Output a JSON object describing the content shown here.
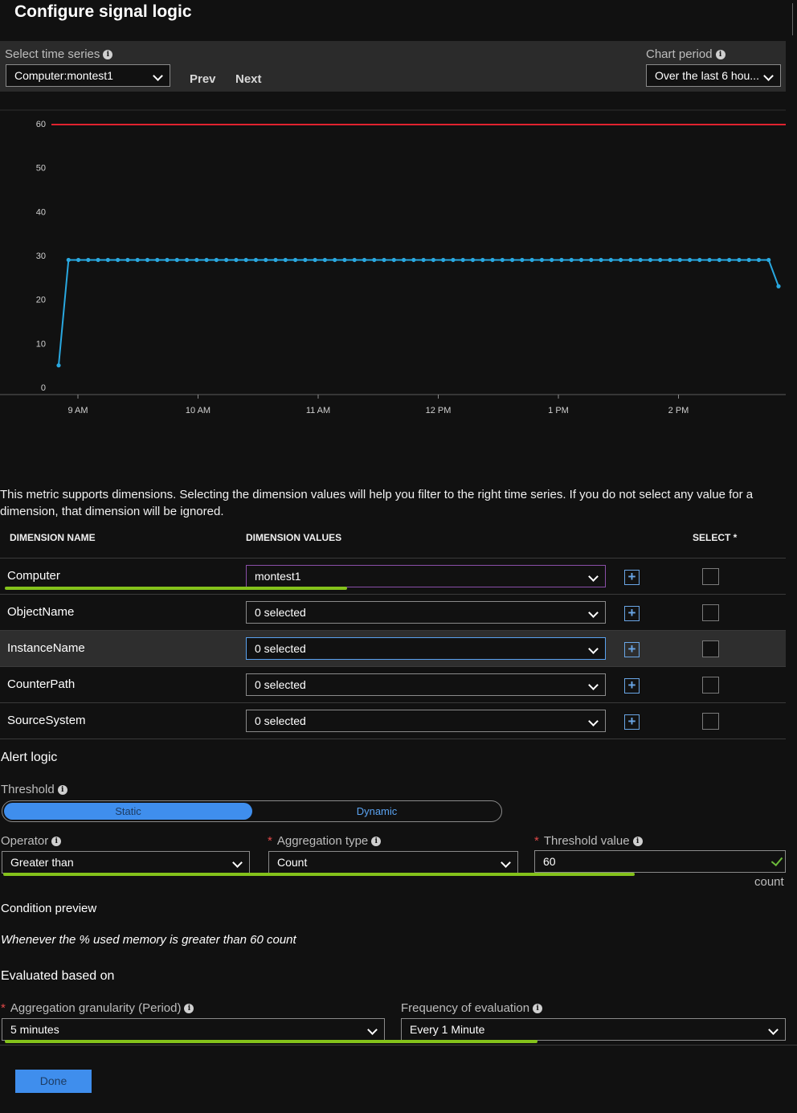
{
  "header": {
    "title": "Configure signal logic"
  },
  "toolbar": {
    "time_series_label": "Select time series",
    "time_series_value": "Computer:montest1",
    "prev_label": "Prev",
    "next_label": "Next",
    "chart_period_label": "Chart period",
    "chart_period_value": "Over the last 6 hou..."
  },
  "chart_data": {
    "type": "line",
    "y_ticks": [
      "60",
      "50",
      "40",
      "30",
      "20",
      "10",
      "0"
    ],
    "ylim": [
      0,
      60
    ],
    "x_ticks": [
      "9 AM",
      "10 AM",
      "11 AM",
      "12 PM",
      "1 PM",
      "2 PM"
    ],
    "threshold": 60,
    "series": [
      {
        "values": [
          5,
          29,
          29,
          29,
          29,
          29,
          29,
          29,
          29,
          29,
          29,
          29,
          29,
          29,
          29,
          29,
          29,
          29,
          29,
          29,
          29,
          29,
          29,
          29,
          29,
          29,
          29,
          29,
          29,
          29,
          29,
          29,
          29,
          29,
          29,
          29,
          29,
          29,
          29,
          29,
          29,
          29,
          29,
          29,
          29,
          29,
          29,
          29,
          29,
          29,
          29,
          29,
          29,
          29,
          29,
          29,
          29,
          29,
          29,
          29,
          29,
          29,
          29,
          29,
          29,
          29,
          29,
          29,
          29,
          29,
          29,
          29,
          29,
          23
        ]
      }
    ],
    "colors": {
      "series": "#29a8e0",
      "threshold": "#e0222f"
    }
  },
  "dimensions": {
    "description": "This metric supports dimensions. Selecting the dimension values will help you filter to the right time series. If you do not select any value for a dimension, that dimension will be ignored.",
    "col_name": "DIMENSION NAME",
    "col_values": "DIMENSION VALUES",
    "col_select": "SELECT *",
    "rows": [
      {
        "name": "Computer",
        "value": "montest1"
      },
      {
        "name": "ObjectName",
        "value": "0 selected"
      },
      {
        "name": "InstanceName",
        "value": "0 selected"
      },
      {
        "name": "CounterPath",
        "value": "0 selected"
      },
      {
        "name": "SourceSystem",
        "value": "0 selected"
      }
    ]
  },
  "alert_logic": {
    "heading": "Alert logic",
    "threshold_label": "Threshold",
    "static_label": "Static",
    "dynamic_label": "Dynamic",
    "operator_label": "Operator",
    "operator_value": "Greater than",
    "aggregation_label": "Aggregation type",
    "aggregation_value": "Count",
    "threshold_value_label": "Threshold value",
    "threshold_value": "60",
    "unit": "count"
  },
  "condition": {
    "heading": "Condition preview",
    "text": "Whenever the % used memory is greater than 60 count"
  },
  "evaluation": {
    "heading": "Evaluated based on",
    "granularity_label": "Aggregation granularity (Period)",
    "granularity_value": "5 minutes",
    "frequency_label": "Frequency of evaluation",
    "frequency_value": "Every 1 Minute"
  },
  "footer": {
    "done_label": "Done"
  },
  "colors": {
    "accent": "#3f8eed",
    "highlight": "#84c21b",
    "required": "#e04848"
  }
}
